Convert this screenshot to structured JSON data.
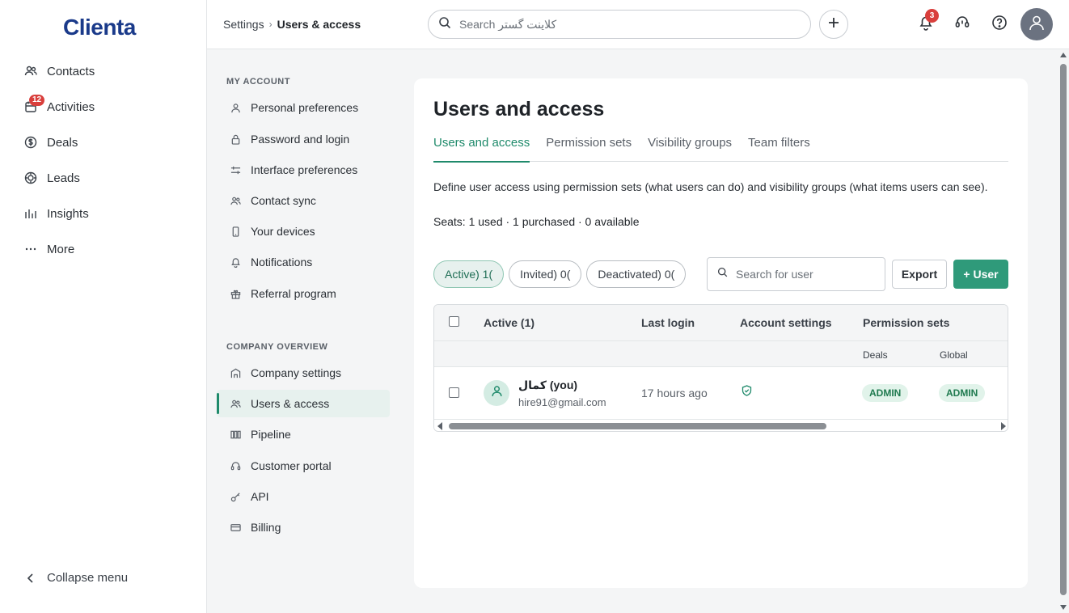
{
  "brand": {
    "logo_text": "Clienta",
    "accent": "#1f8a6b",
    "primary_button": "#2f9a7a",
    "badge_red": "#d93f3c"
  },
  "app_nav": {
    "items": [
      {
        "label": "Contacts",
        "icon": "contacts-icon"
      },
      {
        "label": "Activities",
        "icon": "calendar-icon",
        "badge": "12"
      },
      {
        "label": "Deals",
        "icon": "dollar-icon"
      },
      {
        "label": "Leads",
        "icon": "target-icon"
      },
      {
        "label": "Insights",
        "icon": "bar-chart-icon"
      },
      {
        "label": "More",
        "icon": "ellipsis-icon"
      }
    ],
    "collapse_label": "Collapse menu"
  },
  "header": {
    "breadcrumb_root": "Settings",
    "breadcrumb_sep": "›",
    "breadcrumb_current": "Users & access",
    "search_placeholder": "Search کلاینت گستر",
    "notifications_count": "3"
  },
  "settings_nav": {
    "my_account_title": "MY ACCOUNT",
    "my_account": [
      {
        "label": "Personal preferences",
        "icon": "person-icon"
      },
      {
        "label": "Password and login",
        "icon": "lock-icon"
      },
      {
        "label": "Interface preferences",
        "icon": "sliders-icon"
      },
      {
        "label": "Contact sync",
        "icon": "people-icon"
      },
      {
        "label": "Your devices",
        "icon": "phone-icon"
      },
      {
        "label": "Notifications",
        "icon": "bell-icon"
      },
      {
        "label": "Referral program",
        "icon": "gift-icon"
      }
    ],
    "company_title": "COMPANY OVERVIEW",
    "company": [
      {
        "label": "Company settings",
        "icon": "building-icon"
      },
      {
        "label": "Users & access",
        "icon": "people-icon",
        "active": true
      },
      {
        "label": "Pipeline",
        "icon": "pipeline-icon"
      },
      {
        "label": "Customer portal",
        "icon": "headset-icon"
      },
      {
        "label": "API",
        "icon": "key-icon"
      },
      {
        "label": "Billing",
        "icon": "card-icon"
      }
    ]
  },
  "main": {
    "title": "Users and access",
    "tabs": [
      {
        "label": "Users and access",
        "active": true
      },
      {
        "label": "Permission sets"
      },
      {
        "label": "Visibility groups"
      },
      {
        "label": "Team filters"
      }
    ],
    "description": "Define user access using permission sets (what users can do) and visibility groups (what items users can see).",
    "seats": "Seats: 1 used · 1 purchased · 0 available",
    "filters": [
      {
        "label": "Active) 1(",
        "active": true
      },
      {
        "label": "Invited) 0("
      },
      {
        "label": "Deactivated) 0("
      }
    ],
    "user_search_placeholder": "Search for user",
    "export_label": "Export",
    "add_user_label": "+ User"
  },
  "table": {
    "headers": {
      "name": "Active (1)",
      "last_login": "Last login",
      "account_settings": "Account settings",
      "permission_sets": "Permission sets"
    },
    "sub_headers": {
      "deals": "Deals",
      "global": "Global"
    },
    "rows": [
      {
        "name": "کمال (you)",
        "email": "hire91@gmail.com",
        "last_login": "17 hours ago",
        "deals_permission": "ADMIN",
        "global_permission": "ADMIN"
      }
    ]
  }
}
